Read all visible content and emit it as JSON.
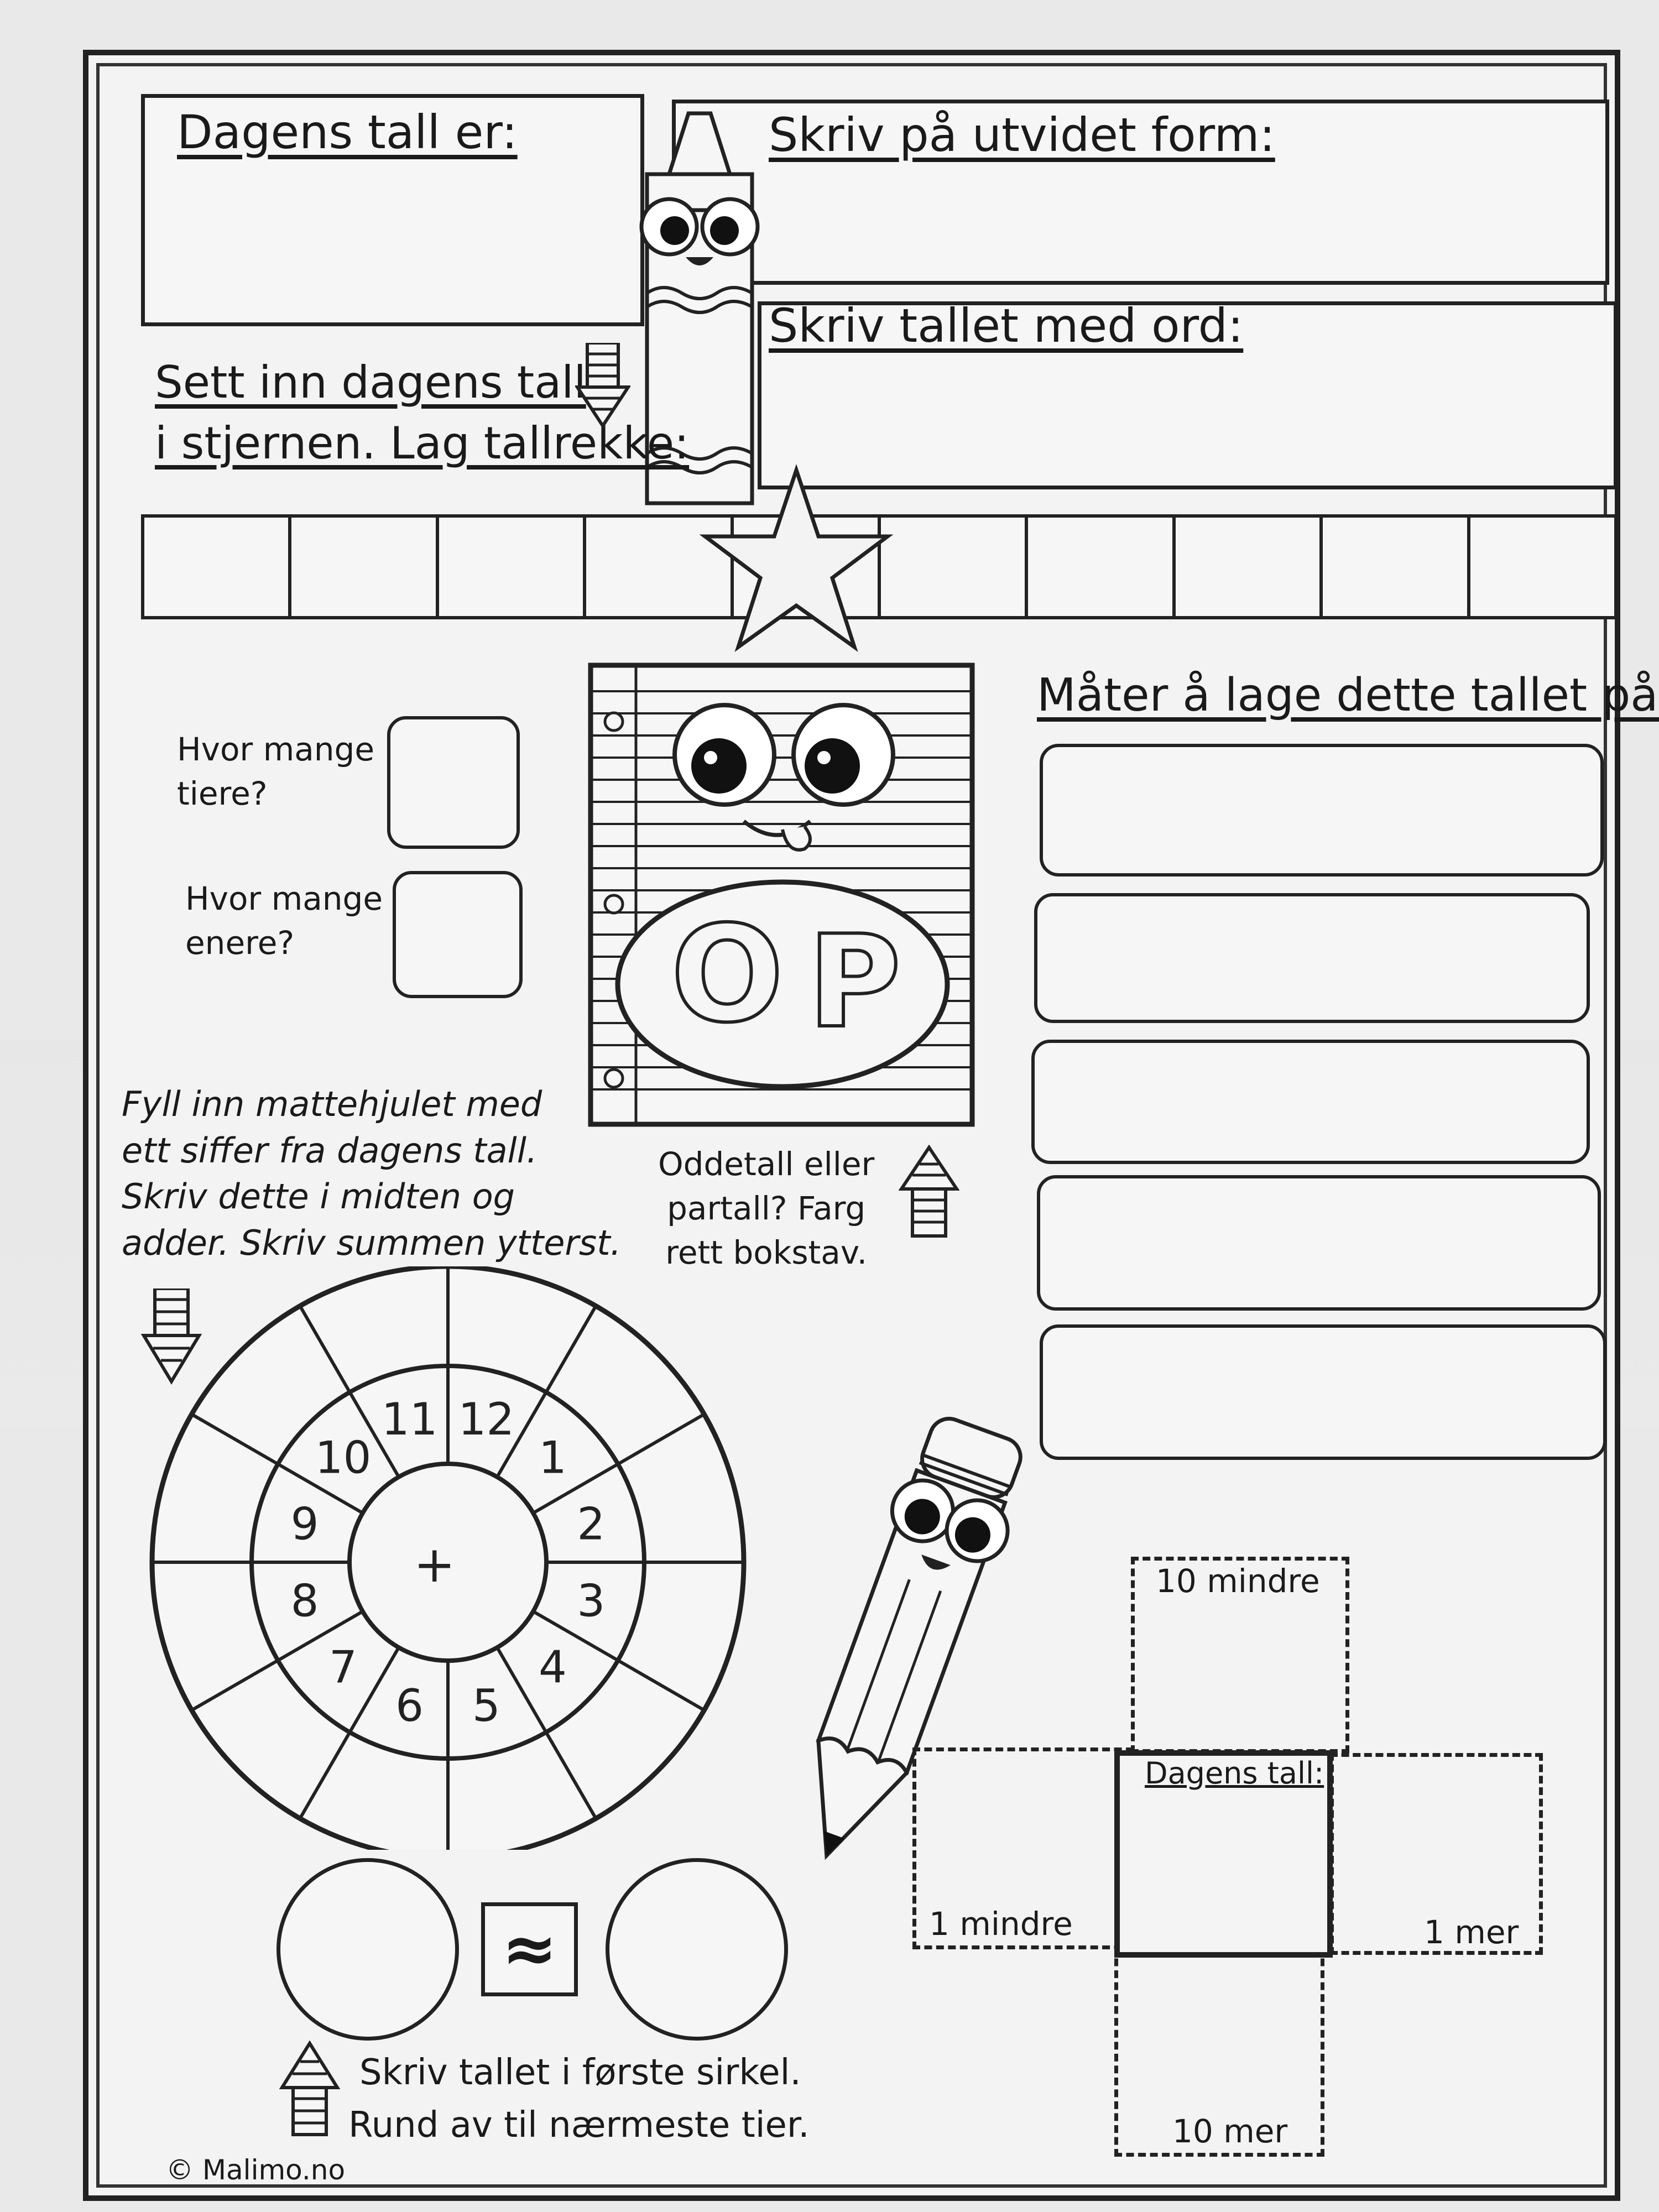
{
  "worksheet": {
    "title_todays_number": "Dagens tall er:",
    "expanded_form": "Skriv på utvidet form:",
    "number_in_words": "Skriv tallet med ord:",
    "star_instruction_line1": "Sett inn dagens tall",
    "star_instruction_line2": "i stjernen. Lag tallrekke:",
    "tens_question": "Hvor mange\ntiere?",
    "ones_question": "Hvor mange\nenere?",
    "ways_title": "Måter å lage dette tallet på:",
    "odd_even_instruction": "Oddetall eller\npartall? Farg\nrett bokstav.",
    "odd_letter": "O",
    "even_letter": "P",
    "wheel_instruction": "Fyll inn mattehjulet med\nett siffer fra dagens tall.\nSkriv dette i midten og\nadder. Skriv summen ytterst.",
    "wheel_center": "+",
    "wheel_numbers": [
      "12",
      "1",
      "2",
      "3",
      "4",
      "5",
      "6",
      "7",
      "8",
      "9",
      "10",
      "11"
    ],
    "approx_symbol": "≈",
    "rounding_line1": "Skriv tallet i første sirkel.",
    "rounding_line2": "Rund av til nærmeste tier.",
    "ten_less": "10 mindre",
    "todays_number_label": "Dagens tall:",
    "one_less": "1 mindre",
    "one_more": "1 mer",
    "ten_more": "10 mer",
    "credit": "© Malimo.no"
  }
}
